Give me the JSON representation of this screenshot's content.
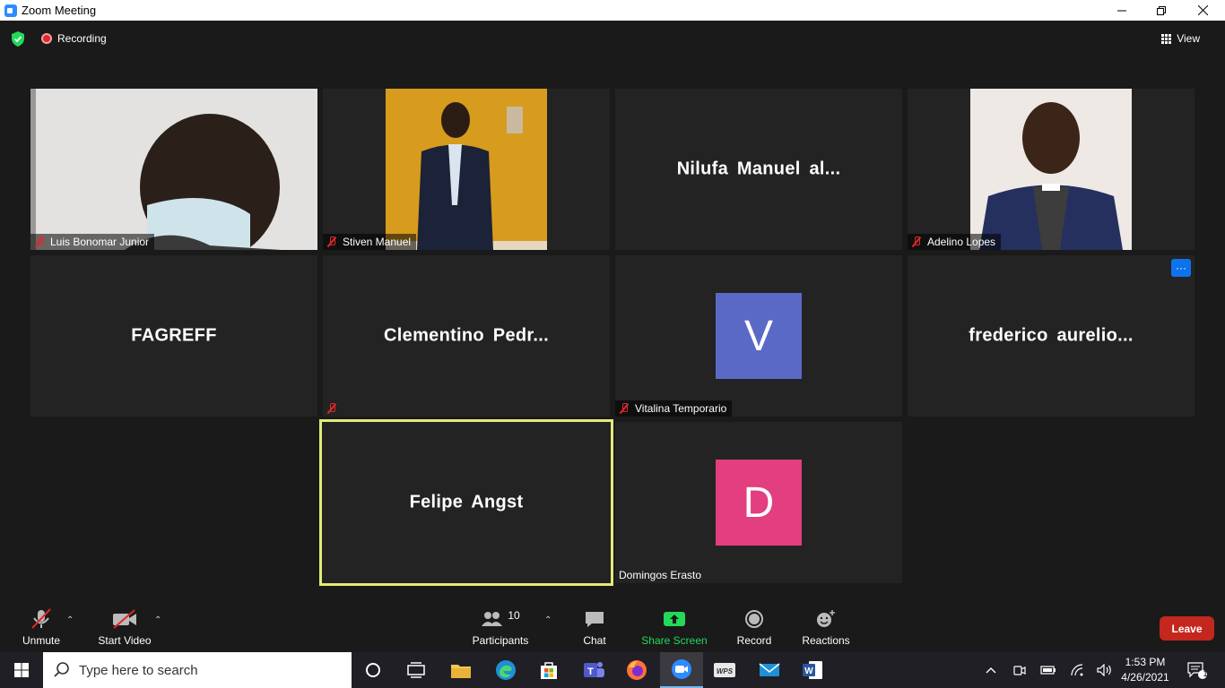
{
  "window": {
    "title": "Zoom Meeting"
  },
  "topbar": {
    "recording_label": "Recording",
    "view_label": "View"
  },
  "tiles": {
    "t1": {
      "name": "Luis Bonomar Junior"
    },
    "t2": {
      "name": "Stiven Manuel"
    },
    "t3": {
      "name": "Nilufa  Manuel  al..."
    },
    "t4": {
      "name": "Adelino Lopes"
    },
    "t5": {
      "name": "FAGREFF"
    },
    "t6": {
      "name": "Clementino  Pedr..."
    },
    "t7": {
      "name": "Vitalina Temporario",
      "initial": "V",
      "color": "#5b69c6"
    },
    "t8": {
      "name": "frederico  aurelio...",
      "more": "···"
    },
    "t9": {
      "name": "Felipe Angst"
    },
    "t10": {
      "name": "Domingos Erasto",
      "initial": "D",
      "color": "#e33e7f"
    }
  },
  "toolbar": {
    "unmute": "Unmute",
    "start_video": "Start Video",
    "participants": "Participants",
    "participants_count": "10",
    "chat": "Chat",
    "share_screen": "Share Screen",
    "record": "Record",
    "reactions": "Reactions",
    "leave": "Leave"
  },
  "taskbar": {
    "search_placeholder": "Type here to search",
    "time": "1:53 PM",
    "date": "4/26/2021",
    "notification_count": "1"
  },
  "colors": {
    "active_speaker_border": "#e3ea7a",
    "leave_button": "#c4271d",
    "share_screen": "#23d959",
    "recording_dot": "#e02828"
  }
}
